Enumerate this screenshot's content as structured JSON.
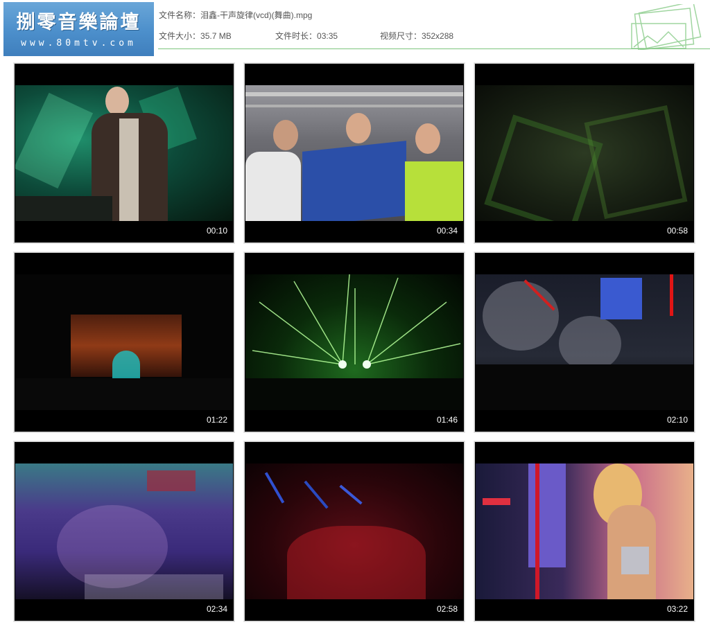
{
  "header": {
    "logo_title": "捌零音樂論壇",
    "logo_url": "www.80mtv.com",
    "file_name_label": "文件名称：",
    "file_name": "泪鑫-干声旋律(vcd)(舞曲).mpg",
    "file_size_label": "文件大小：",
    "file_size": "35.7 MB",
    "duration_label": "文件时长：",
    "duration": "03:35",
    "video_size_label": "视频尺寸：",
    "video_size": "352x288"
  },
  "thumbnails": [
    {
      "time": "00:10"
    },
    {
      "time": "00:34"
    },
    {
      "time": "00:58"
    },
    {
      "time": "01:22"
    },
    {
      "time": "01:46"
    },
    {
      "time": "02:10"
    },
    {
      "time": "02:34"
    },
    {
      "time": "02:58"
    },
    {
      "time": "03:22"
    }
  ],
  "colors": {
    "accent_green": "#7cc47c",
    "logo_blue": "#4c8fcb"
  }
}
